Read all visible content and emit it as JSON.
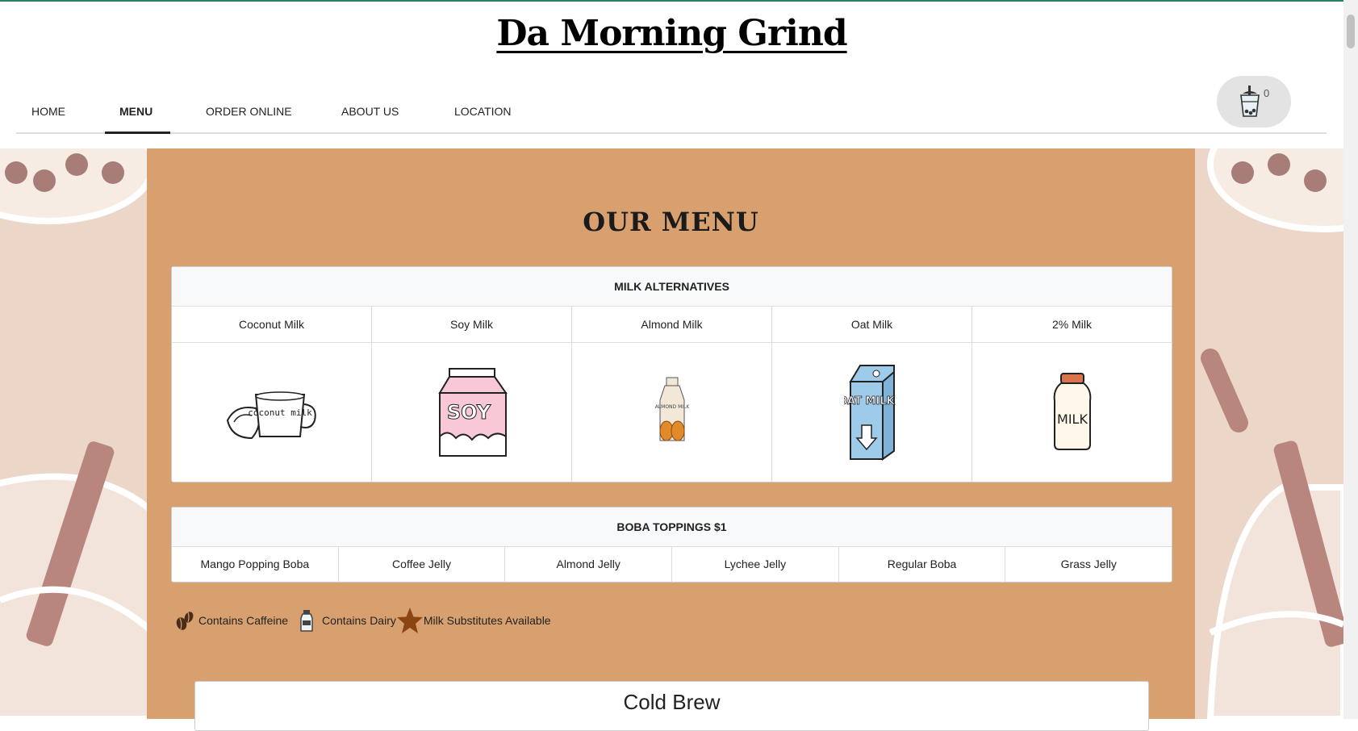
{
  "site": {
    "title": "Da Morning Grind"
  },
  "nav": {
    "items": [
      {
        "label": "HOME"
      },
      {
        "label": "MENU"
      },
      {
        "label": "ORDER ONLINE"
      },
      {
        "label": "ABOUT US"
      },
      {
        "label": "LOCATION"
      }
    ],
    "active": "MENU"
  },
  "cart": {
    "count": "0",
    "icon": "boba-cup-icon"
  },
  "menu": {
    "title": "OUR MENU",
    "milk_alternatives": {
      "heading": "MILK ALTERNATIVES",
      "items": [
        {
          "name": "Coconut Milk",
          "image_text": "coconut milk"
        },
        {
          "name": "Soy Milk",
          "image_text": "SOY"
        },
        {
          "name": "Almond Milk",
          "image_text": "ALMOND MILK"
        },
        {
          "name": "Oat Milk",
          "image_text": "OAT MILK"
        },
        {
          "name": "2% Milk",
          "image_text": "MILK"
        }
      ]
    },
    "toppings": {
      "heading": "BOBA TOPPINGS $1",
      "items": [
        "Mango Popping Boba",
        "Coffee Jelly",
        "Almond Jelly",
        "Lychee Jelly",
        "Regular Boba",
        "Grass Jelly"
      ]
    },
    "legend": [
      {
        "icon": "coffee-beans-icon",
        "label": "Contains Caffeine"
      },
      {
        "icon": "milk-bottle-icon",
        "label": "Contains Dairy"
      },
      {
        "icon": "star-icon",
        "label": "Milk Substitutes Available"
      }
    ],
    "section_title": "Cold Brew"
  },
  "colors": {
    "panel": "#d9a06f",
    "accent_line": "#2e7d5b",
    "background": "#ebd6c8",
    "star": "#8b4513"
  }
}
